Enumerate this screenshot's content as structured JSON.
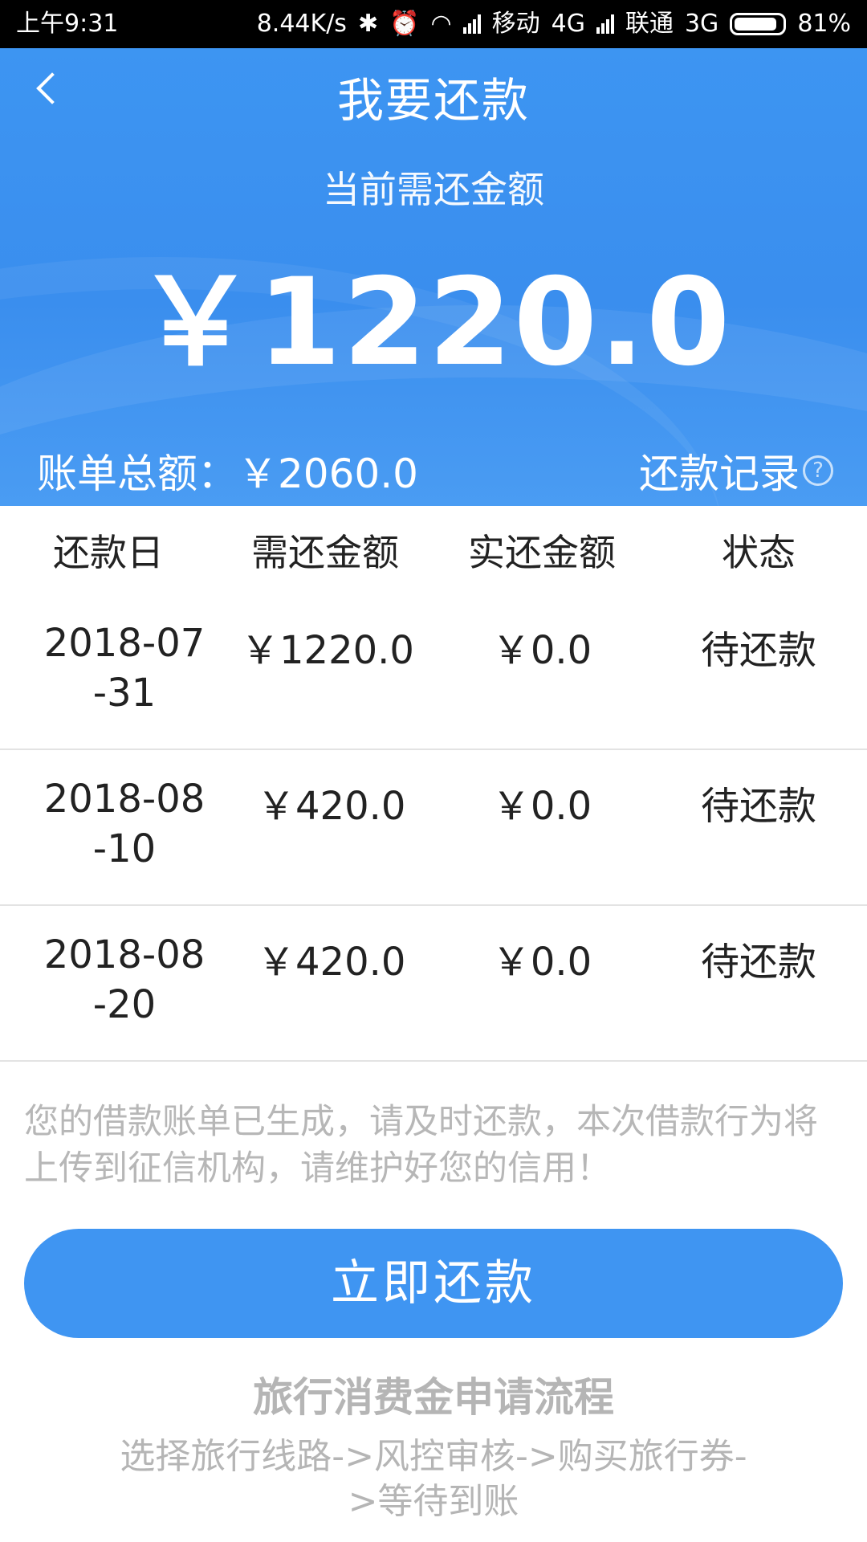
{
  "status_bar": {
    "time": "上午9:31",
    "net_speed": "8.44K/s",
    "carrier1": "移动",
    "network1": "4G",
    "carrier2": "联通",
    "network2": "3G",
    "battery": "81%"
  },
  "header": {
    "title": "我要还款",
    "amount_label": "当前需还金额",
    "amount_value": "￥1220.0",
    "bill_total": "账单总额：￥2060.0",
    "repay_record": "还款记录",
    "help_icon": "?"
  },
  "table": {
    "headers": [
      "还款日",
      "需还金额",
      "实还金额",
      "状态"
    ],
    "rows": [
      {
        "date": "2018-07-31",
        "due": "￥1220.0",
        "paid": "￥0.0",
        "status": "待还款"
      },
      {
        "date": "2018-08-10",
        "due": "￥420.0",
        "paid": "￥0.0",
        "status": "待还款"
      },
      {
        "date": "2018-08-20",
        "due": "￥420.0",
        "paid": "￥0.0",
        "status": "待还款"
      }
    ]
  },
  "notice": "您的借款账单已生成，请及时还款，本次借款行为将上传到征信机构，请维护好您的信用！",
  "pay_button": "立即还款",
  "flow": {
    "title": "旅行消费金申请流程",
    "steps": "选择旅行线路->风控审核->购买旅行券->等待到账"
  },
  "colors": {
    "primary": "#3f95f2",
    "muted_text": "#b7b7b7"
  }
}
